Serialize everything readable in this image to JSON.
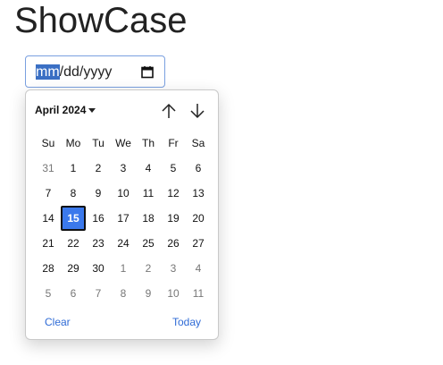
{
  "page": {
    "title": "ShowCase"
  },
  "date_input": {
    "month_segment": "mm",
    "sep1": "/",
    "day_segment": "dd",
    "sep2": "/",
    "year_segment": "yyyy",
    "calendar_icon": "calendar-icon",
    "focus_border_color": "#7aa0e0",
    "selected_segment_color": "#3a6fc4"
  },
  "picker": {
    "month_label": "April 2024",
    "prev_icon": "arrow-up-icon",
    "next_icon": "arrow-down-icon",
    "weekdays": [
      "Su",
      "Mo",
      "Tu",
      "We",
      "Th",
      "Fr",
      "Sa"
    ],
    "weeks": [
      [
        {
          "d": "31",
          "muted": true
        },
        {
          "d": "1"
        },
        {
          "d": "2"
        },
        {
          "d": "3"
        },
        {
          "d": "4"
        },
        {
          "d": "5"
        },
        {
          "d": "6"
        }
      ],
      [
        {
          "d": "7"
        },
        {
          "d": "8"
        },
        {
          "d": "9"
        },
        {
          "d": "10"
        },
        {
          "d": "11"
        },
        {
          "d": "12"
        },
        {
          "d": "13"
        }
      ],
      [
        {
          "d": "14"
        },
        {
          "d": "15",
          "selected": true
        },
        {
          "d": "16"
        },
        {
          "d": "17"
        },
        {
          "d": "18"
        },
        {
          "d": "19"
        },
        {
          "d": "20"
        }
      ],
      [
        {
          "d": "21"
        },
        {
          "d": "22"
        },
        {
          "d": "23"
        },
        {
          "d": "24"
        },
        {
          "d": "25"
        },
        {
          "d": "26"
        },
        {
          "d": "27"
        }
      ],
      [
        {
          "d": "28"
        },
        {
          "d": "29"
        },
        {
          "d": "30"
        },
        {
          "d": "1",
          "muted": true
        },
        {
          "d": "2",
          "muted": true
        },
        {
          "d": "3",
          "muted": true
        },
        {
          "d": "4",
          "muted": true
        }
      ],
      [
        {
          "d": "5",
          "muted": true
        },
        {
          "d": "6",
          "muted": true
        },
        {
          "d": "7",
          "muted": true
        },
        {
          "d": "8",
          "muted": true
        },
        {
          "d": "9",
          "muted": true
        },
        {
          "d": "10",
          "muted": true
        },
        {
          "d": "11",
          "muted": true
        }
      ]
    ],
    "clear_label": "Clear",
    "today_label": "Today",
    "selected_color": "#3b79ec",
    "link_color": "#2f6bd6"
  }
}
